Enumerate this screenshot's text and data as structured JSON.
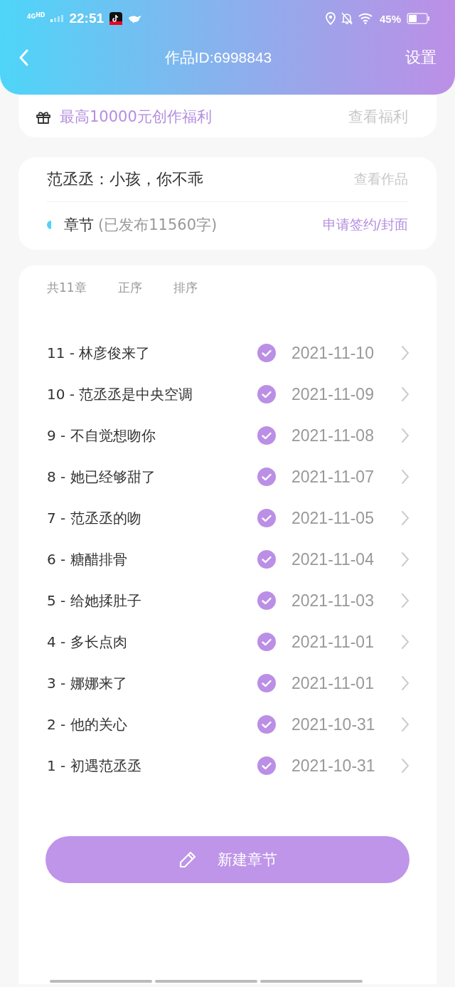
{
  "status_bar": {
    "network": "4G",
    "network_extra": "HD",
    "time": "22:51",
    "battery": "45%"
  },
  "nav": {
    "title": "作品ID:6998843",
    "action": "设置"
  },
  "benefit": {
    "text": "最高10000元创作福利",
    "link": "查看福利"
  },
  "work": {
    "title": "范丞丞：小孩，你不乖",
    "link": "查看作品",
    "section": "章节",
    "count": "(已发布11560字)",
    "action": "申请签约/封面"
  },
  "chapter_list": {
    "total": "共11章",
    "sort_order": "正序",
    "sort": "排序",
    "chapters": [
      {
        "title": "11 - 林彦俊来了",
        "published": true,
        "date": "2021-11-10"
      },
      {
        "title": "10 - 范丞丞是中央空调",
        "published": true,
        "date": "2021-11-09"
      },
      {
        "title": "9 - 不自觉想吻你",
        "published": true,
        "date": "2021-11-08"
      },
      {
        "title": "8 - 她已经够甜了",
        "published": true,
        "date": "2021-11-07"
      },
      {
        "title": "7 - 范丞丞的吻",
        "published": true,
        "date": "2021-11-05"
      },
      {
        "title": "6 - 糖醋排骨",
        "published": true,
        "date": "2021-11-04"
      },
      {
        "title": "5 - 给她揉肚子",
        "published": true,
        "date": "2021-11-03"
      },
      {
        "title": "4 - 多长点肉",
        "published": true,
        "date": "2021-11-01"
      },
      {
        "title": "3 - 娜娜来了",
        "published": true,
        "date": "2021-11-01"
      },
      {
        "title": "2 - 他的关心",
        "published": true,
        "date": "2021-10-31"
      },
      {
        "title": "1 - 初遇范丞丞",
        "published": true,
        "date": "2021-10-31"
      }
    ],
    "new_button": "新建章节"
  }
}
